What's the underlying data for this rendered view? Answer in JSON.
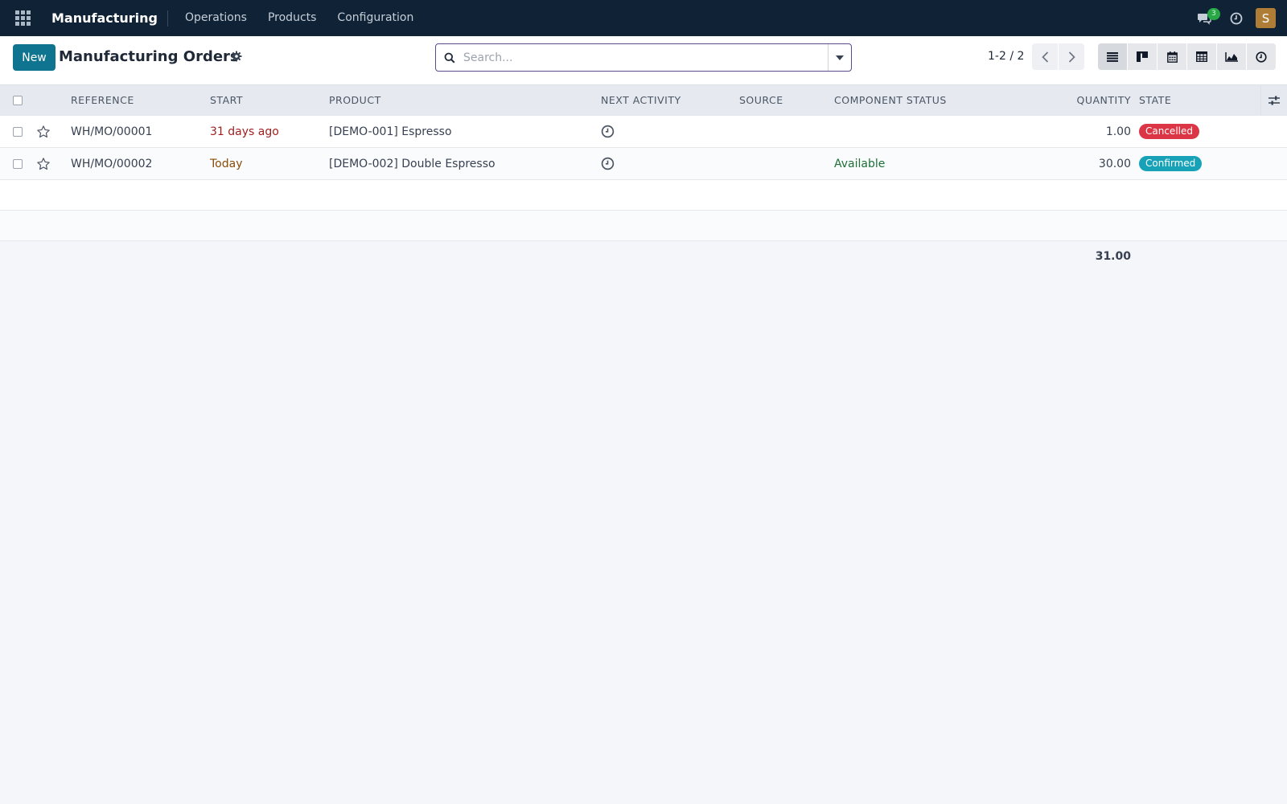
{
  "navbar": {
    "app_name": "Manufacturing",
    "menu": [
      {
        "label": "Operations"
      },
      {
        "label": "Products"
      },
      {
        "label": "Configuration"
      }
    ],
    "messages_count": "3",
    "user_initial": "S"
  },
  "control_panel": {
    "new_label": "New",
    "title": "Manufacturing Orders",
    "search_placeholder": "Search...",
    "pager": "1-2 / 2",
    "views": [
      "list",
      "kanban",
      "calendar",
      "pivot",
      "graph",
      "activity"
    ]
  },
  "table": {
    "columns": {
      "reference": "REFERENCE",
      "start": "START",
      "product": "PRODUCT",
      "next_activity": "NEXT ACTIVITY",
      "source": "SOURCE",
      "component_status": "COMPONENT STATUS",
      "quantity": "QUANTITY",
      "state": "STATE"
    },
    "rows": [
      {
        "reference": "WH/MO/00001",
        "start": "31 days ago",
        "product": "[DEMO-001] Espresso",
        "source": "",
        "component_status": "",
        "quantity": "1.00",
        "state": "Cancelled",
        "state_color": "#dc3545"
      },
      {
        "reference": "WH/MO/00002",
        "start": "Today",
        "product": "[DEMO-002] Double Espresso",
        "source": "",
        "component_status": "Available",
        "quantity": "30.00",
        "state": "Confirmed",
        "state_color": "#17a2b8"
      }
    ],
    "total_quantity": "31.00"
  },
  "colors": {
    "navbar_bg": "#0f2236",
    "primary": "#0e7490",
    "avatar": "#b07d36",
    "cancelled": "#dc3545",
    "confirmed": "#17a2b8"
  }
}
